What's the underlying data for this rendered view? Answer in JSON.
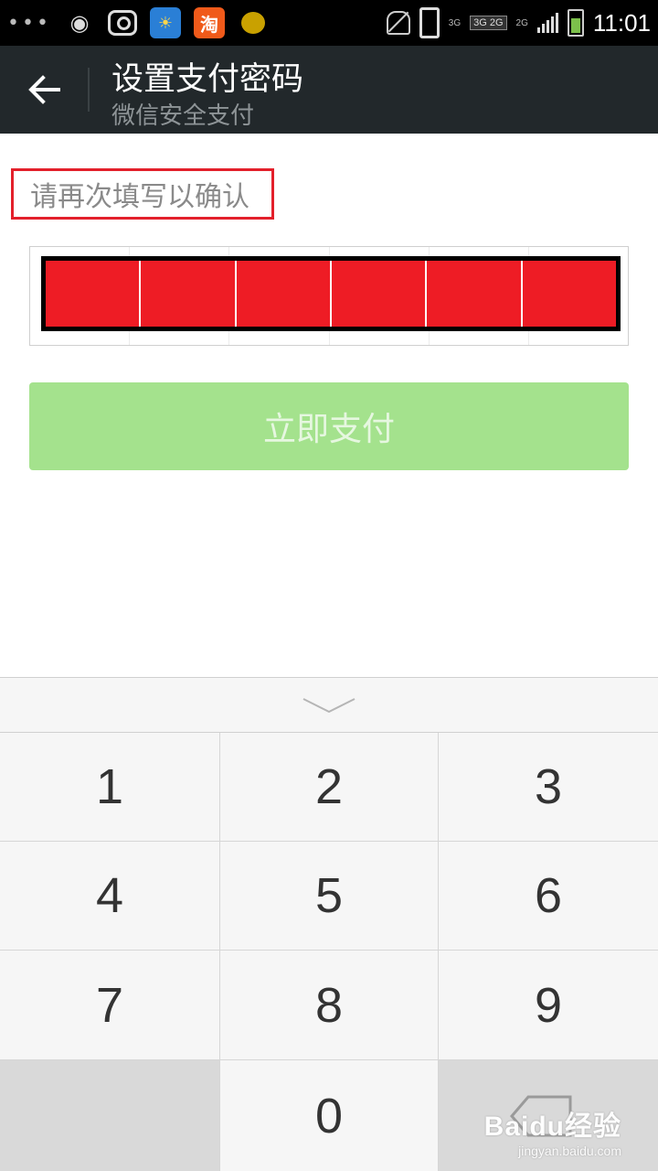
{
  "status_bar": {
    "time": "11:01",
    "net_3g": "3G",
    "net_2g": "2G",
    "net_box": "3G 2G",
    "net_2g_bars": "2G",
    "icons": [
      "more-dots",
      "weibo",
      "camera",
      "weather",
      "taobao",
      "chat-bubble",
      "bell-muted",
      "phone-vibrate",
      "signal",
      "battery"
    ]
  },
  "header": {
    "title": "设置支付密码",
    "subtitle": "微信安全支付",
    "back_icon": "arrow-left-icon"
  },
  "prompt": {
    "text": "请再次填写以确认",
    "highlight_color": "#e3202b"
  },
  "password": {
    "length": 6,
    "cell_fill": "#ee1c25"
  },
  "pay_button": {
    "label": "立即支付",
    "color": "#a4e28d"
  },
  "keypad": {
    "keys": [
      "1",
      "2",
      "3",
      "4",
      "5",
      "6",
      "7",
      "8",
      "9",
      "",
      "0",
      ""
    ],
    "collapse_icon": "chevron-down-icon"
  },
  "watermark": {
    "brand": "Baidu经验",
    "url": "jingyan.baidu.com"
  }
}
